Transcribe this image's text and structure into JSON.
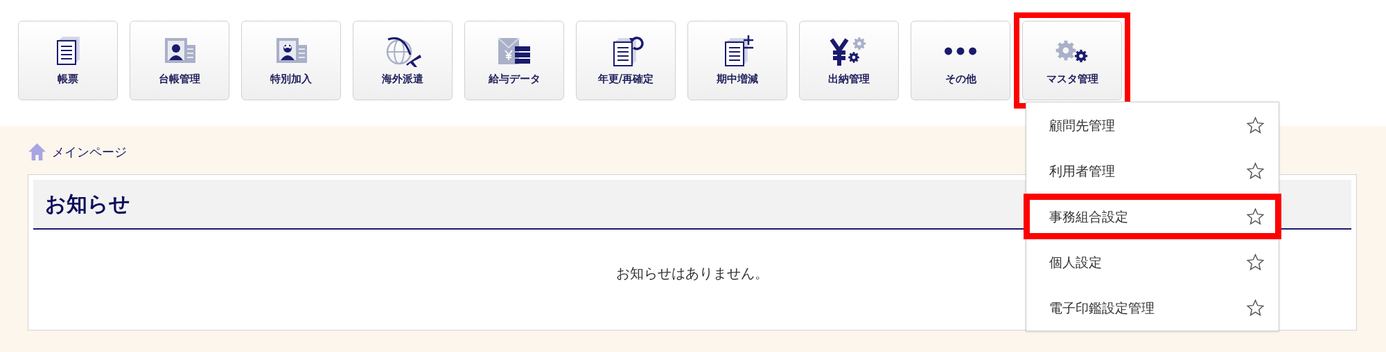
{
  "toolbar": [
    {
      "label": "帳票",
      "kind": "documents",
      "highlighted": false
    },
    {
      "label": "台帳管理",
      "kind": "id-card",
      "highlighted": false
    },
    {
      "label": "特別加入",
      "kind": "helmet-card",
      "highlighted": false
    },
    {
      "label": "海外派遣",
      "kind": "globe-plane",
      "highlighted": false
    },
    {
      "label": "給与データ",
      "kind": "envelope-yen",
      "highlighted": false
    },
    {
      "label": "年更/再確定",
      "kind": "documents-refresh",
      "highlighted": false
    },
    {
      "label": "期中増減",
      "kind": "documents-plusminus",
      "highlighted": false
    },
    {
      "label": "出納管理",
      "kind": "yen-gears",
      "highlighted": false
    },
    {
      "label": "その他",
      "kind": "dots",
      "highlighted": false
    },
    {
      "label": "マスタ管理",
      "kind": "gears",
      "highlighted": true
    }
  ],
  "breadcrumb": {
    "label": "メインページ"
  },
  "notice_panel": {
    "title": "お知らせ",
    "message": "お知らせはありません。"
  },
  "dropdown": {
    "items": [
      {
        "label": "顧問先管理",
        "starred": false,
        "highlighted": false
      },
      {
        "label": "利用者管理",
        "starred": false,
        "highlighted": false
      },
      {
        "label": "事務組合設定",
        "starred": false,
        "highlighted": true
      },
      {
        "label": "個人設定",
        "starred": false,
        "highlighted": false
      },
      {
        "label": "電子印鑑設定管理",
        "starred": false,
        "highlighted": false
      }
    ]
  }
}
